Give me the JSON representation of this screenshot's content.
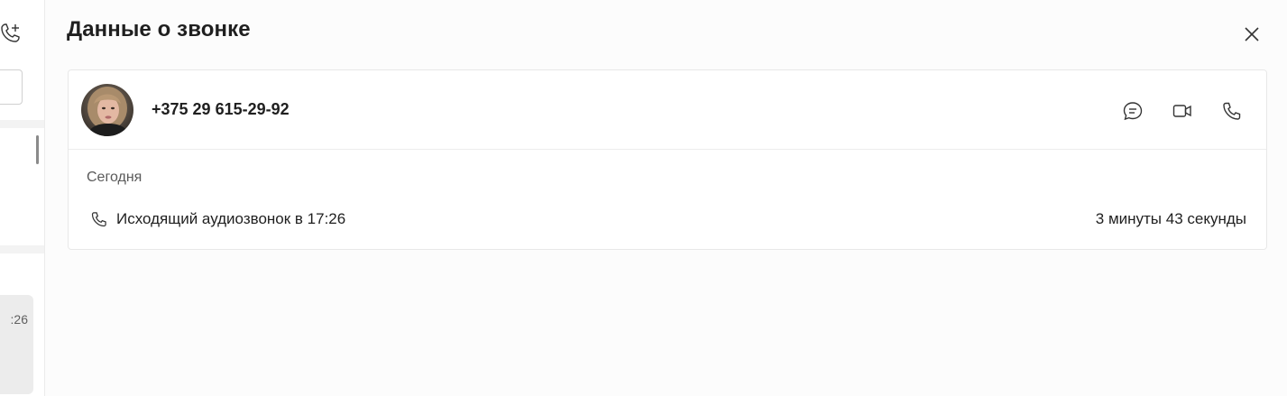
{
  "left_panel": {
    "card_time": ":26"
  },
  "dialog": {
    "title": "Данные о звонке",
    "contact": {
      "phone": "+375 29 615-29-92"
    },
    "actions": {
      "chat_icon": "chat-icon",
      "video_icon": "video-camera-icon",
      "call_icon": "phone-icon"
    },
    "history": {
      "date_label": "Сегодня",
      "calls": [
        {
          "description": "Исходящий аудиозвонок в 17:26",
          "duration": "3 минуты 43 секунды",
          "icon": "phone-icon"
        }
      ]
    }
  }
}
